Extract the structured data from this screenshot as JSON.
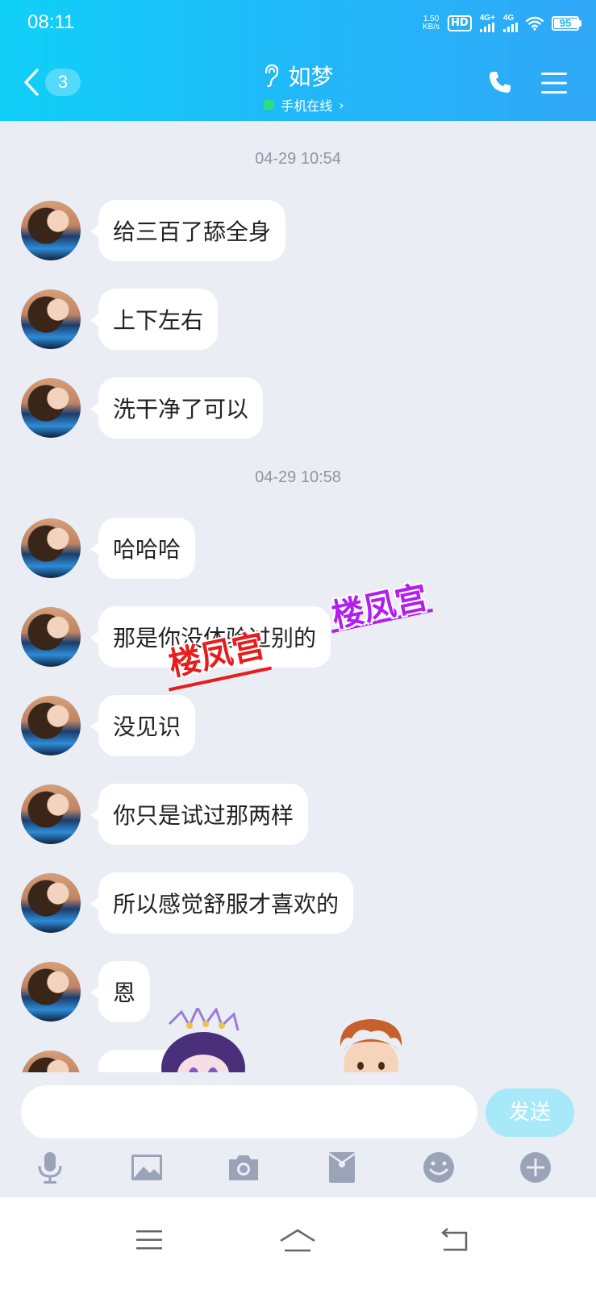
{
  "status_bar": {
    "time": "08:11",
    "net_speed_value": "1.50",
    "net_speed_unit": "KB/s",
    "hd_label": "HD",
    "signal1_label": "4G+",
    "signal2_label": "4G",
    "battery": "95"
  },
  "header": {
    "unread_count": "3",
    "contact_name": "如梦",
    "online_status": "手机在线",
    "online_chevron": "›",
    "icons": [
      "back-icon",
      "ear-icon",
      "phone-icon",
      "menu-icon"
    ]
  },
  "chat": {
    "timestamps": [
      "04-29 10:54",
      "04-29 10:58"
    ],
    "messages": [
      {
        "text": "给三百了舔全身"
      },
      {
        "text": "上下左右"
      },
      {
        "text": "洗干净了可以"
      },
      {
        "text": "哈哈哈"
      },
      {
        "text": "那是你没体验过别的"
      },
      {
        "text": "没见识"
      },
      {
        "text": "你只是试过那两样"
      },
      {
        "text": "所以感觉舒服才喜欢的"
      },
      {
        "text": "恩"
      }
    ],
    "watermarks": [
      "楼凤宫",
      "楼凤宫"
    ]
  },
  "input": {
    "value": "",
    "send_label": "发送"
  },
  "toolbar_icons": [
    "microphone-icon",
    "image-icon",
    "camera-icon",
    "red-packet-icon",
    "emoji-icon",
    "plus-icon"
  ],
  "colors": {
    "header_start": "#10d0f8",
    "header_end": "#30a8f8",
    "chat_bg": "#eaedf4",
    "bubble_bg": "#ffffff",
    "send_button": "#a7e9f9",
    "online_dot": "#2be07a"
  }
}
